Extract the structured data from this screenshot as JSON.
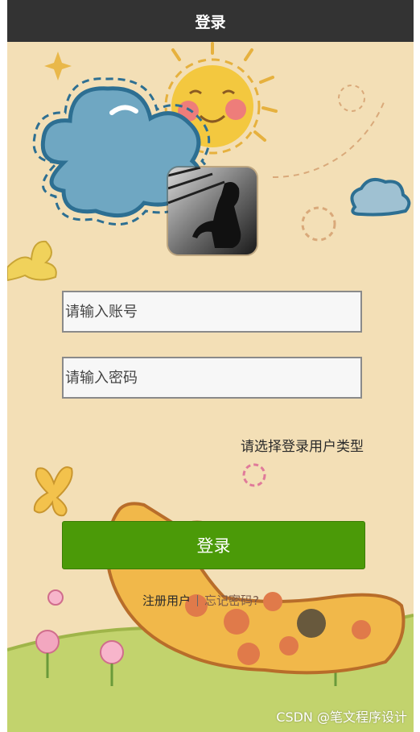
{
  "header": {
    "title": "登录"
  },
  "form": {
    "account_placeholder": "请输入账号",
    "password_placeholder": "请输入密码",
    "user_type_label": "请选择登录用户类型",
    "login_button": "登录",
    "register_link": "注册用户",
    "forgot_link": "忘记密码?"
  },
  "watermark": "CSDN @笔文程序设计",
  "colors": {
    "header_bg": "#333333",
    "background": "#f3dfb6",
    "login_button_bg": "#4b9a08"
  }
}
